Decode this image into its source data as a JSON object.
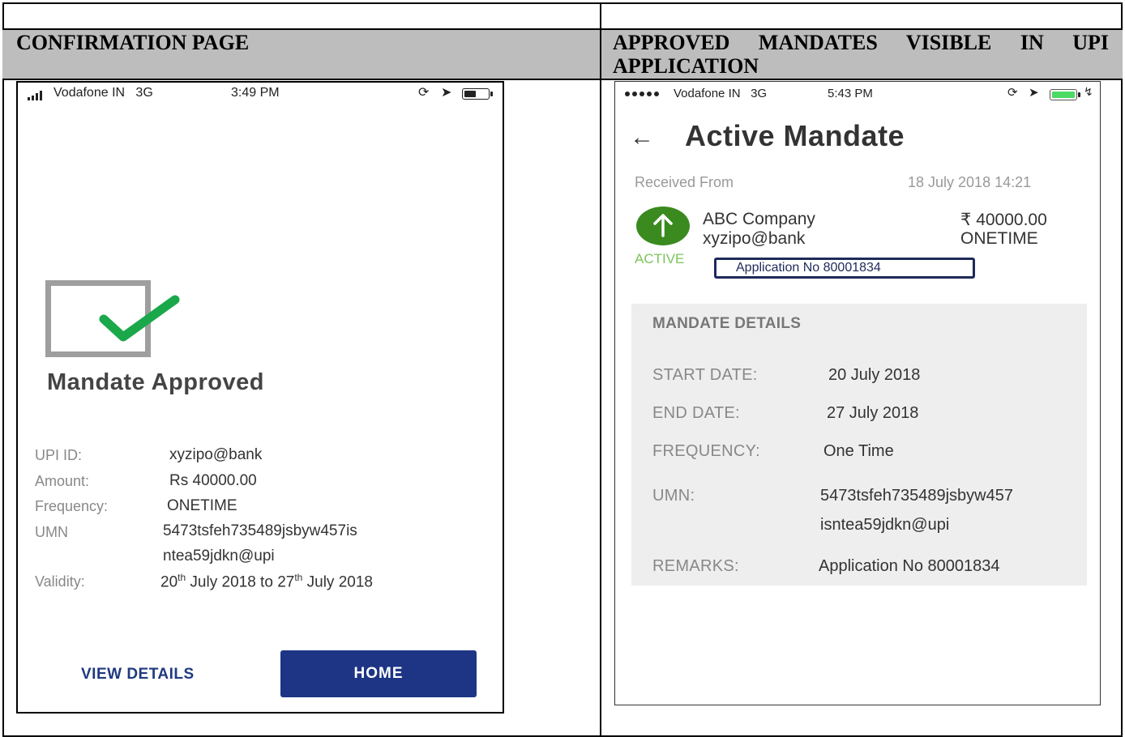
{
  "headers": {
    "left": "CONFIRMATION PAGE",
    "right_line1": "APPROVED MANDATES VISIBLE IN UPI",
    "right_line2": "APPLICATION"
  },
  "left_phone": {
    "status": {
      "carrier": "Vodafone IN",
      "network": "3G",
      "time": "3:49 PM"
    },
    "title": "Mandate Approved",
    "details": {
      "upi_label": "UPI ID:",
      "upi_value": "xyzipo@bank",
      "amount_label": "Amount:",
      "amount_value": "Rs 40000.00",
      "frequency_label": "Frequency:",
      "frequency_value": "ONETIME",
      "umn_label": "UMN",
      "umn_value_line1": "5473tsfeh735489jsbyw457is",
      "umn_value_line2": "ntea59jdkn@upi",
      "validity_label": "Validity:",
      "validity_start_day": "20",
      "validity_start_sup": "th",
      "validity_start_rest": " July 2018 to ",
      "validity_end_day": "27",
      "validity_end_sup": "th",
      "validity_end_rest": " July 2018"
    },
    "buttons": {
      "view_details": "VIEW DETAILS",
      "home": "HOME"
    },
    "colors": {
      "check": "#1aa84a",
      "primary": "#1d3584"
    }
  },
  "right_phone": {
    "status": {
      "carrier": "Vodafone IN",
      "network": "3G",
      "time": "5:43 PM"
    },
    "title": "Active Mandate",
    "received_label": "Received From",
    "received_time": "18 July 2018 14:21",
    "company": "ABC Company",
    "vpa": "xyzipo@bank",
    "amount": "₹ 40000.00",
    "frequency": "ONETIME",
    "status_badge": "ACTIVE",
    "application_box": "Application No 80001834",
    "mandate_details": {
      "title": "MANDATE DETAILS",
      "start_label": "START DATE:",
      "start_value": "20 July 2018",
      "end_label": "END DATE:",
      "end_value": "27 July 2018",
      "frequency_label": "FREQUENCY:",
      "frequency_value": "One Time",
      "umn_label": "UMN:",
      "umn_line1": "5473tsfeh735489jsbyw457",
      "umn_line2": "isntea59jdkn@upi",
      "remarks_label": "REMARKS:",
      "remarks_value": "Application No 80001834"
    },
    "colors": {
      "avatar": "#3a8a1f",
      "active": "#7bc55b",
      "battery": "#4cd964"
    }
  }
}
